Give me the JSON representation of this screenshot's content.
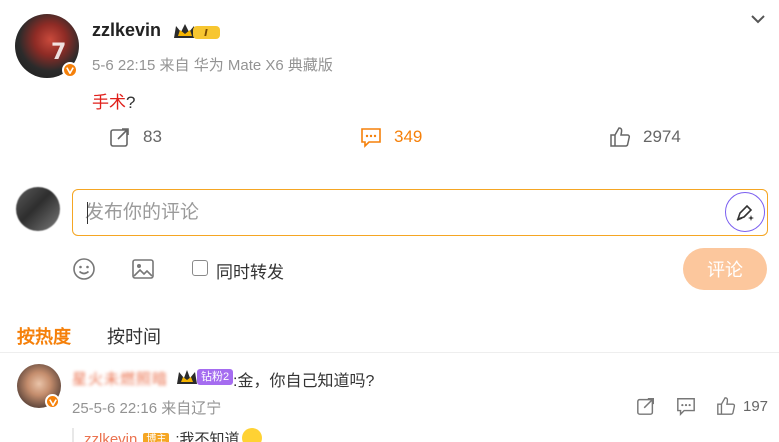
{
  "post": {
    "username": "zzlkevin",
    "avatar_number": "7",
    "member_badge": "I",
    "meta": "5-6 22:15  来自 华为 Mate X6 典藏版",
    "text_highlight": "手术",
    "text_rest": "?",
    "repost_count": "83",
    "comment_count": "349",
    "like_count": "2974"
  },
  "composer": {
    "placeholder": "发布你的评论",
    "sync_label": "同时转发",
    "submit_label": "评论"
  },
  "sort": {
    "hot_label": "按热度",
    "time_label": "按时间"
  },
  "comment": {
    "author": "星火未燃照暗",
    "fan_badge": "钻粉2",
    "text": ":金，你自己知道吗?",
    "meta": "25-5-6 22:16 来自辽宁",
    "like_count": "197"
  },
  "reply": {
    "author": "zzlkevin",
    "badge": "博主",
    "text": ":我不知道"
  },
  "colors": {
    "accent": "#f5800a",
    "link_red": "#e0201b",
    "input_border": "#f5a623",
    "submit_bg": "#fcc79d",
    "fan_badge": "#a56cf0"
  }
}
